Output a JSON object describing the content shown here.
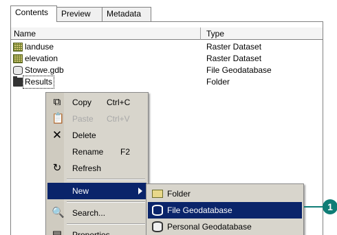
{
  "tabs": [
    {
      "label": "Contents"
    },
    {
      "label": "Preview"
    },
    {
      "label": "Metadata"
    }
  ],
  "columns": {
    "name": "Name",
    "type": "Type"
  },
  "rows": [
    {
      "name": "landuse",
      "type": "Raster Dataset",
      "icon": "raster-icon"
    },
    {
      "name": "elevation",
      "type": "Raster Dataset",
      "icon": "raster-icon"
    },
    {
      "name": "Stowe.gdb",
      "type": "File Geodatabase",
      "icon": "geodatabase-icon"
    },
    {
      "name": "Results",
      "type": "Folder",
      "icon": "folder-icon"
    }
  ],
  "context_menu": {
    "copy": {
      "label": "Copy",
      "shortcut": "Ctrl+C",
      "icon": "copy-icon"
    },
    "paste": {
      "label": "Paste",
      "shortcut": "Ctrl+V",
      "icon": "paste-icon"
    },
    "delete": {
      "label": "Delete",
      "icon": "delete-icon"
    },
    "rename": {
      "label": "Rename",
      "shortcut": "F2"
    },
    "refresh": {
      "label": "Refresh",
      "icon": "refresh-icon"
    },
    "new": {
      "label": "New"
    },
    "search": {
      "label": "Search...",
      "icon": "search-icon"
    },
    "properties": {
      "label": "Properties",
      "icon": "properties-icon"
    }
  },
  "submenu": {
    "folder": {
      "label": "Folder"
    },
    "file_gdb": {
      "label": "File Geodatabase"
    },
    "personal_gdb": {
      "label": "Personal Geodatabase"
    }
  },
  "callout": {
    "number": "1"
  },
  "colors": {
    "highlight": "#0a246a",
    "callout": "#0f7d76",
    "menu_bg": "#d8d5cc"
  }
}
